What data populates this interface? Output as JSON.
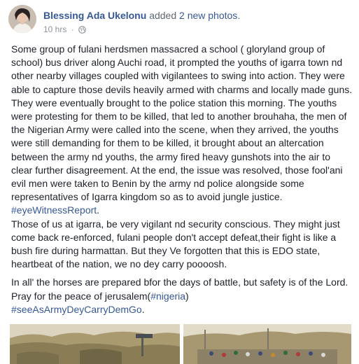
{
  "post": {
    "author": "Blessing Ada Ukelonu",
    "action_added": "added",
    "action_photos": "2 new photos",
    "action_end": ".",
    "time": "10 hrs",
    "separator": "·",
    "privacy_icon": "globe-icon",
    "paragraph1": "Some group of fulani herdsmen massacred a school ( gloryland group of school) bus driver along Auchi road, it prompted the youths of igarra town nd other nearby villages coupled with vigilantees to swing into action. They were able to capture those devils heavily armed with charms and locally made guns. They were eventually brought to the police station this morning. The youths were protesting for them to be killed, that led to another brouhaha, the men of the Nigerian Army were called into the scene, when they arrived, the youths were still demanding for them to be killed, it brought about an altercation between the army nd youths, the army fired heavy gunshots into the air to clear further disagreement. At the end, the issue was resolved, those fool'ani evil men were taken to Benin by the army nd police alongside some representatives of Igarra kingdom so as to avoid jungle justice.",
    "hashtag1": "#eyeWitnessReport",
    "hashtag1_suffix": ".",
    "paragraph2": "Those of us at igarra, be very vigilant nd security conscious. They might just come back re-enforced, fulani people don't accept defeat,their fight is like a bush fire during harmattan. But they Ve forgotten that this is EDO state, heartbeat of the nation, we no dey carry poooosh.",
    "paragraph3_text": "In all' the horses are prepared bfor the days of battle, but safety is of the Lord. Pray for the peace of jerusalem(",
    "hashtag2": "#nigeria",
    "paragraph3_close": ")",
    "hashtag3": "#seeAsArmyDeyCarryDemGo",
    "hashtag3_suffix": "."
  },
  "colors": {
    "link": "#365899",
    "text": "#1d2129",
    "meta": "#90949c"
  }
}
